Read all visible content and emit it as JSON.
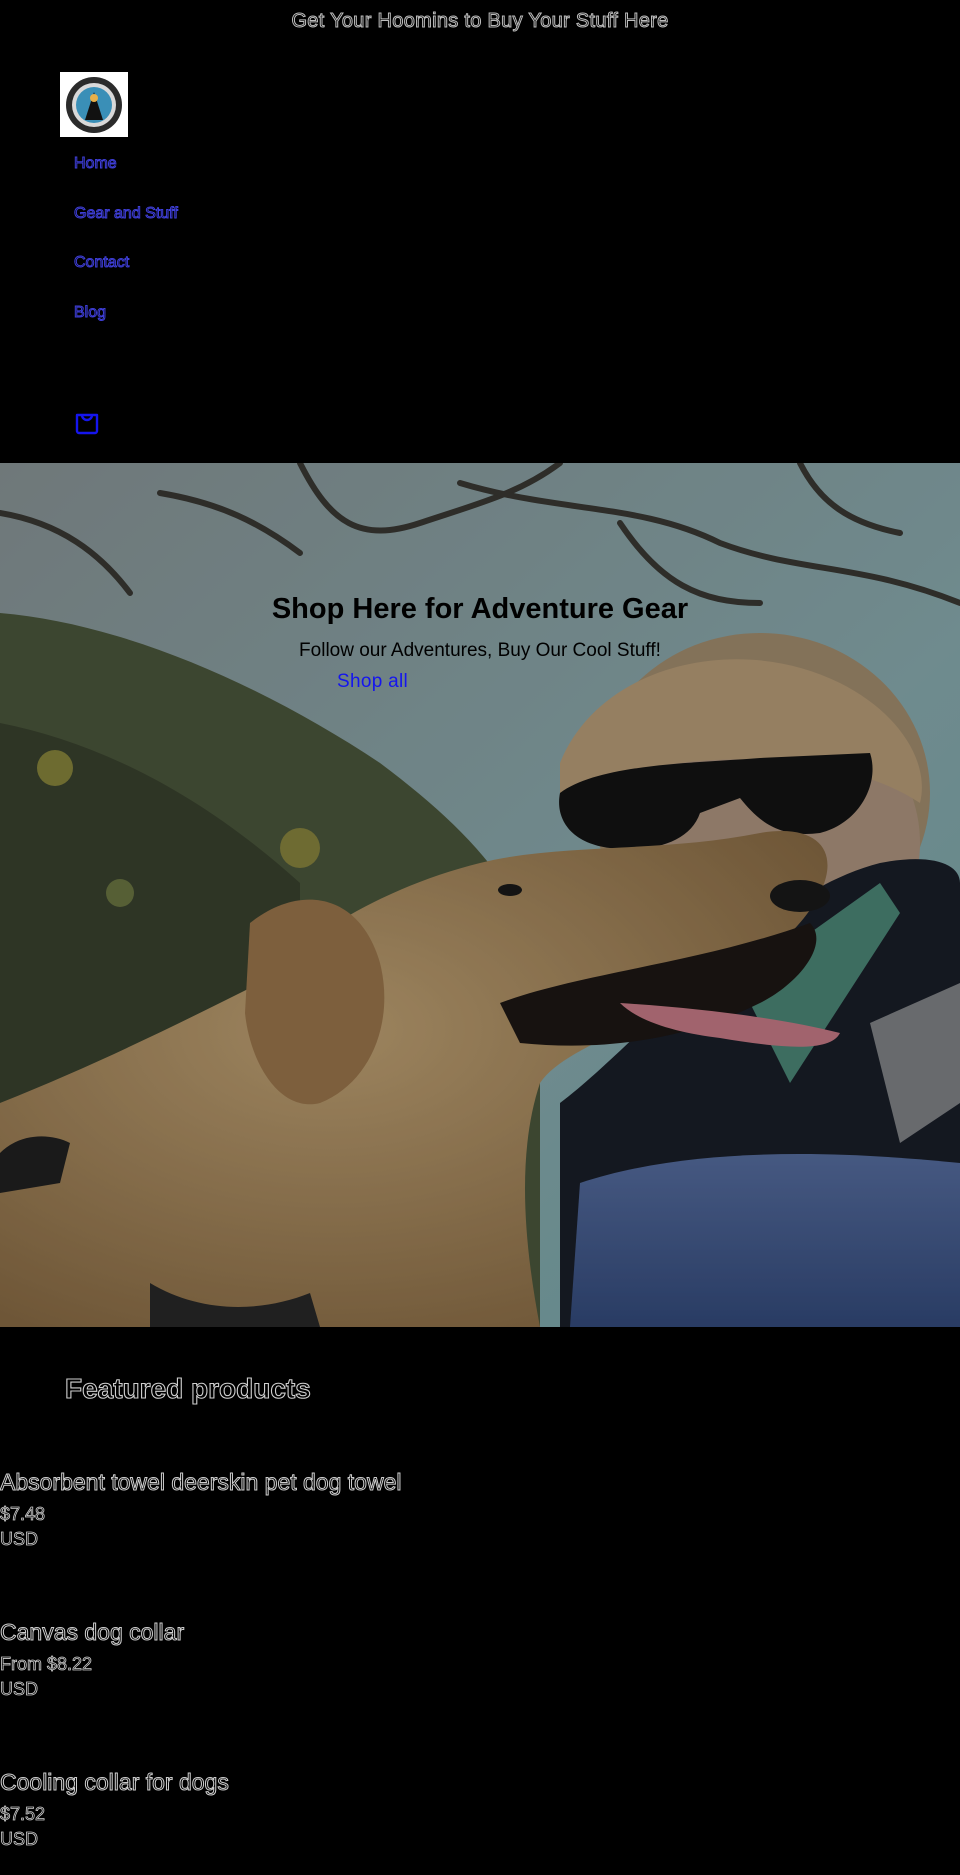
{
  "announcement": "Get Your Hoomins to Buy Your Stuff Here",
  "header": {
    "nav": [
      {
        "label": "Home"
      },
      {
        "label": "Gear and Stuff"
      },
      {
        "label": "Contact"
      },
      {
        "label": "Blog"
      }
    ],
    "cart_icon": "cart-icon"
  },
  "hero": {
    "title": "Shop Here for Adventure Gear",
    "subtitle": "Follow our Adventures, Buy Our Cool Stuff!",
    "button": "Shop all",
    "image": "golden retriever and woman in sunglasses"
  },
  "featured": {
    "heading": "Featured products",
    "products": [
      {
        "title": "Absorbent towel deerskin pet dog towel",
        "price": "$7.48",
        "currency": "USD"
      },
      {
        "title": "Canvas dog collar",
        "price": "From $8.22",
        "currency": "USD"
      },
      {
        "title": "Cooling collar for dogs",
        "price": "$7.52",
        "currency": "USD"
      }
    ]
  },
  "colors": {
    "background": "#000000",
    "link": "#1515ee",
    "nav_outline": "#3f3fd9"
  }
}
